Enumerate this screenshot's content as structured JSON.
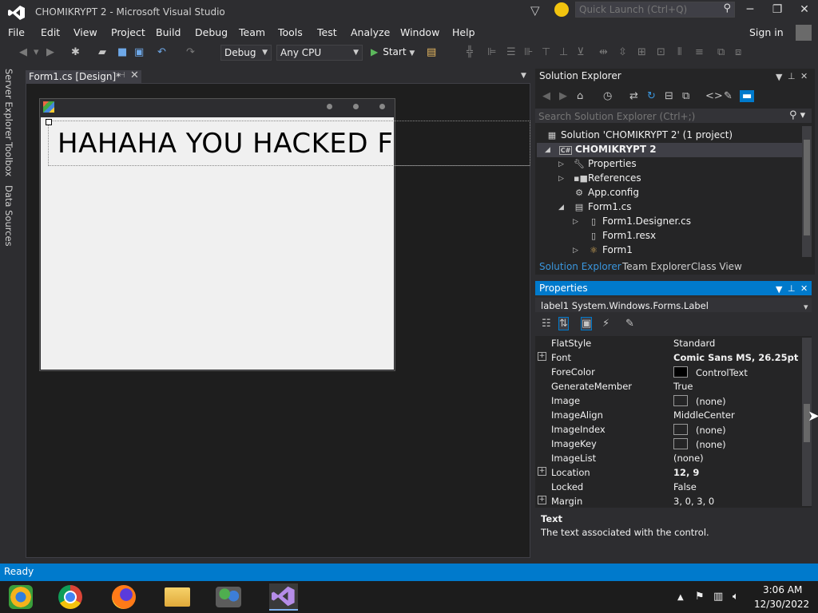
{
  "window": {
    "title": "CHOMIKRYPT 2 - Microsoft Visual Studio",
    "quick_launch_placeholder": "Quick Launch (Ctrl+Q)",
    "sign_in": "Sign in"
  },
  "menu": [
    "File",
    "Edit",
    "View",
    "Project",
    "Build",
    "Debug",
    "Team",
    "Tools",
    "Test",
    "Analyze",
    "Window",
    "Help"
  ],
  "toolbar": {
    "configuration": "Debug",
    "platform": "Any CPU",
    "start_label": "Start"
  },
  "side_tabs": [
    "Server Explorer",
    "Toolbox",
    "Data Sources"
  ],
  "document": {
    "tab_label": "Form1.cs [Design]*",
    "label_text": "HAHAHA YOU HACKED F"
  },
  "solution_explorer": {
    "title": "Solution Explorer",
    "search_placeholder": "Search Solution Explorer (Ctrl+;)",
    "tree": [
      {
        "label": "Solution 'CHOMIKRYPT 2' (1 project)",
        "icon": "solution-icon"
      },
      {
        "label": "CHOMIKRYPT 2",
        "icon": "csharp-project-icon"
      },
      {
        "label": "Properties",
        "icon": "wrench-icon"
      },
      {
        "label": "References",
        "icon": "references-icon"
      },
      {
        "label": "App.config",
        "icon": "config-file-icon"
      },
      {
        "label": "Form1.cs",
        "icon": "form-file-icon"
      },
      {
        "label": "Form1.Designer.cs",
        "icon": "cs-file-icon"
      },
      {
        "label": "Form1.resx",
        "icon": "resx-file-icon"
      },
      {
        "label": "Form1",
        "icon": "class-icon"
      }
    ],
    "bottom_tabs": [
      "Solution Explorer",
      "Team Explorer",
      "Class View"
    ]
  },
  "properties": {
    "title": "Properties",
    "object": "label1  System.Windows.Forms.Label",
    "rows": [
      {
        "name": "FlatStyle",
        "value": "Standard"
      },
      {
        "name": "Font",
        "value": "Comic Sans MS, 26.25pt"
      },
      {
        "name": "ForeColor",
        "value": "ControlText"
      },
      {
        "name": "GenerateMember",
        "value": "True"
      },
      {
        "name": "Image",
        "value": "(none)"
      },
      {
        "name": "ImageAlign",
        "value": "MiddleCenter"
      },
      {
        "name": "ImageIndex",
        "value": "(none)"
      },
      {
        "name": "ImageKey",
        "value": "(none)"
      },
      {
        "name": "ImageList",
        "value": "(none)"
      },
      {
        "name": "Location",
        "value": "12, 9"
      },
      {
        "name": "Locked",
        "value": "False"
      },
      {
        "name": "Margin",
        "value": "3, 0, 3, 0"
      }
    ],
    "description_title": "Text",
    "description_text": "The text associated with the control."
  },
  "status": "Ready",
  "taskbar": {
    "apps": [
      "media-player-icon",
      "chrome-icon",
      "firefox-icon",
      "file-explorer-icon",
      "people-icon",
      "visual-studio-icon"
    ],
    "time": "3:06 AM",
    "date": "12/30/2022"
  },
  "colors": {
    "accent": "#007acc",
    "background": "#2d2d30",
    "panel": "#252526"
  }
}
